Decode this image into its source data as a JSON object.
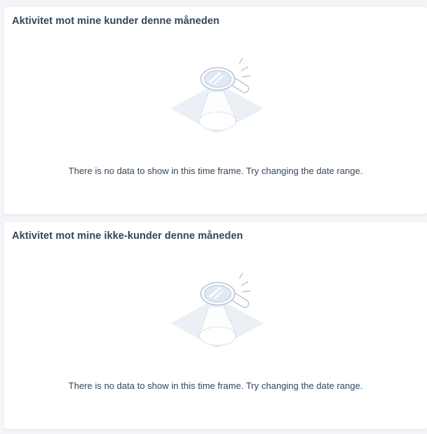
{
  "cards": [
    {
      "title": "Aktivitet mot mine kunder denne måneden",
      "empty_message": "There is no data to show in this time frame. Try changing the date range.",
      "illustration_icon": "magnifying-glass-spotlight-icon"
    },
    {
      "title": "Aktivitet mot mine ikke-kunder denne måneden",
      "empty_message": "There is no data to show in this time frame. Try changing the date range.",
      "illustration_icon": "magnifying-glass-spotlight-icon"
    }
  ],
  "colors": {
    "background": "#f3f5f8",
    "card": "#ffffff",
    "text": "#33475b",
    "illustration_stroke": "#b9c6d6",
    "illustration_fill": "#eaf0f6",
    "illustration_lens": "#dfe9f3"
  }
}
